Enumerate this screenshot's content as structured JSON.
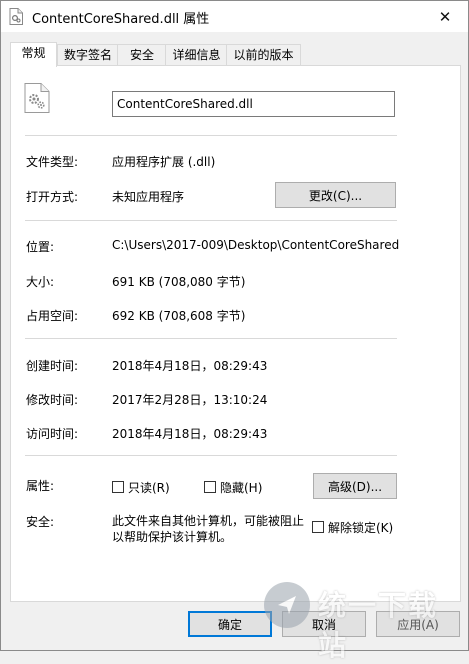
{
  "window": {
    "title": "ContentCoreShared.dll 属性",
    "close_glyph": "✕"
  },
  "tabs": [
    {
      "label": "常规"
    },
    {
      "label": "数字签名"
    },
    {
      "label": "安全"
    },
    {
      "label": "详细信息"
    },
    {
      "label": "以前的版本"
    }
  ],
  "general": {
    "filename": "ContentCoreShared.dll",
    "file_type_label": "文件类型:",
    "file_type_value": "应用程序扩展 (.dll)",
    "opens_with_label": "打开方式:",
    "opens_with_value": "未知应用程序",
    "change_button": "更改(C)...",
    "location_label": "位置:",
    "location_value": "C:\\Users\\2017-009\\Desktop\\ContentCoreShared",
    "size_label": "大小:",
    "size_value": "691 KB (708,080 字节)",
    "size_on_disk_label": "占用空间:",
    "size_on_disk_value": "692 KB (708,608 字节)",
    "created_label": "创建时间:",
    "created_value": "2018年4月18日，08:29:43",
    "modified_label": "修改时间:",
    "modified_value": "2017年2月28日，13:10:24",
    "accessed_label": "访问时间:",
    "accessed_value": "2018年4月18日，08:29:43",
    "attributes_label": "属性:",
    "readonly_label": "只读(R)",
    "hidden_label": "隐藏(H)",
    "advanced_button": "高级(D)...",
    "security_label": "安全:",
    "security_text": "此文件来自其他计算机，可能被阻止以帮助保护该计算机。",
    "unblock_label": "解除锁定(K)"
  },
  "footer": {
    "ok": "确定",
    "cancel": "取消",
    "apply": "应用(A)"
  },
  "watermark": {
    "text": "统一下载站"
  },
  "colors": {
    "focus_border": "#0078d7",
    "panel_bg": "#ffffff",
    "window_bg": "#f0f0f0"
  }
}
